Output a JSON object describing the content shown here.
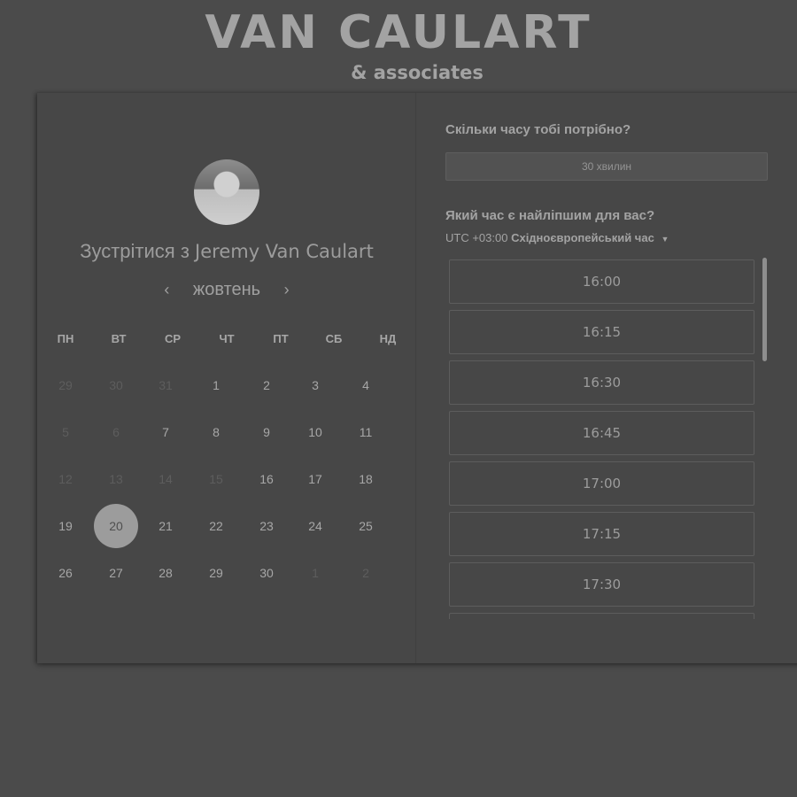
{
  "brand": {
    "title": "VAN CAULART",
    "subtitle": "& associates"
  },
  "left": {
    "avatar_icon": "profile-photo",
    "meet_prefix": "Зустрітися з",
    "meet_name": "Jeremy Van Caulart",
    "prev_label": "‹",
    "next_label": "›",
    "month": "жовтень",
    "weekdays": [
      "ПН",
      "ВТ",
      "СР",
      "ЧТ",
      "ПТ",
      "СБ",
      "НД"
    ],
    "weeks": [
      [
        {
          "d": "29",
          "muted": true
        },
        {
          "d": "30",
          "muted": true
        },
        {
          "d": "31",
          "muted": true
        },
        {
          "d": "1"
        },
        {
          "d": "2"
        },
        {
          "d": "3"
        },
        {
          "d": "4"
        }
      ],
      [
        {
          "d": "5",
          "muted": true
        },
        {
          "d": "6",
          "muted": true
        },
        {
          "d": "7"
        },
        {
          "d": "8"
        },
        {
          "d": "9"
        },
        {
          "d": "10"
        },
        {
          "d": "11"
        }
      ],
      [
        {
          "d": "12",
          "muted": true
        },
        {
          "d": "13",
          "muted": true
        },
        {
          "d": "14",
          "muted": true
        },
        {
          "d": "15",
          "muted": true
        },
        {
          "d": "16"
        },
        {
          "d": "17"
        },
        {
          "d": "18"
        }
      ],
      [
        {
          "d": "19"
        },
        {
          "d": "20",
          "selected": true
        },
        {
          "d": "21"
        },
        {
          "d": "22"
        },
        {
          "d": "23"
        },
        {
          "d": "24"
        },
        {
          "d": "25"
        }
      ],
      [
        {
          "d": "26"
        },
        {
          "d": "27"
        },
        {
          "d": "28"
        },
        {
          "d": "29"
        },
        {
          "d": "30"
        },
        {
          "d": "1",
          "muted": true
        },
        {
          "d": "2",
          "muted": true
        }
      ]
    ]
  },
  "right": {
    "duration_question": "Скільки часу тобі потрібно?",
    "duration_value": "30 хвилин",
    "time_question": "Який час є найліпшим для вас?",
    "tz_offset": "UTC +03:00",
    "tz_name": "Східноєвропейський час",
    "tz_caret": "▼",
    "slots": [
      "16:00",
      "16:15",
      "16:30",
      "16:45",
      "17:00",
      "17:15",
      "17:30",
      ""
    ]
  }
}
